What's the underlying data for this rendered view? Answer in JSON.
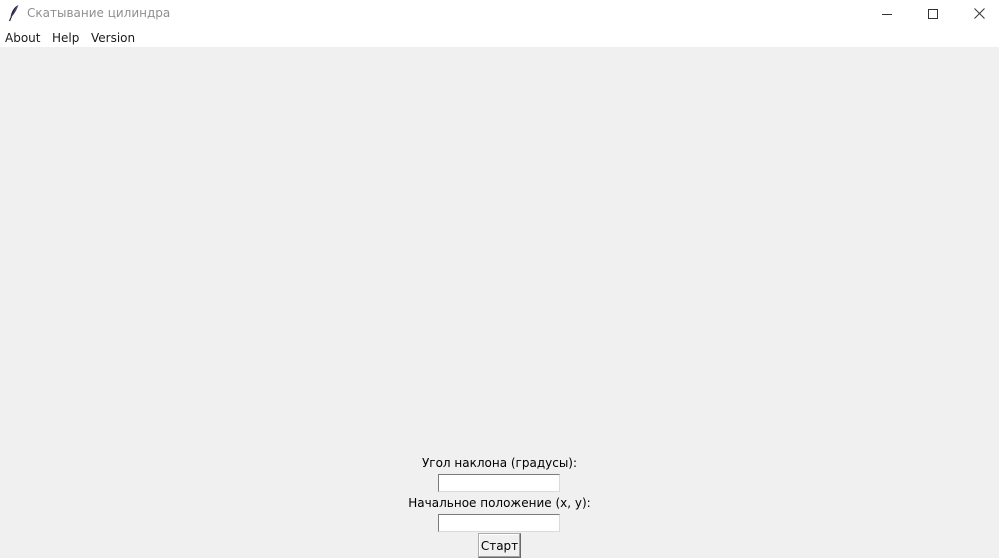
{
  "window": {
    "title": "Скатывание цилиндра",
    "icon": "feather-icon",
    "controls": [
      "minimize-icon",
      "maximize-icon",
      "close-icon"
    ]
  },
  "menu": {
    "items": [
      {
        "label": "About"
      },
      {
        "label": "Help"
      },
      {
        "label": "Version"
      }
    ]
  },
  "form": {
    "angle_label": "Угол наклона (градусы):",
    "angle_value": "",
    "position_label": "Начальное положение (x, y):",
    "position_value": "",
    "start_label": "Старт"
  }
}
